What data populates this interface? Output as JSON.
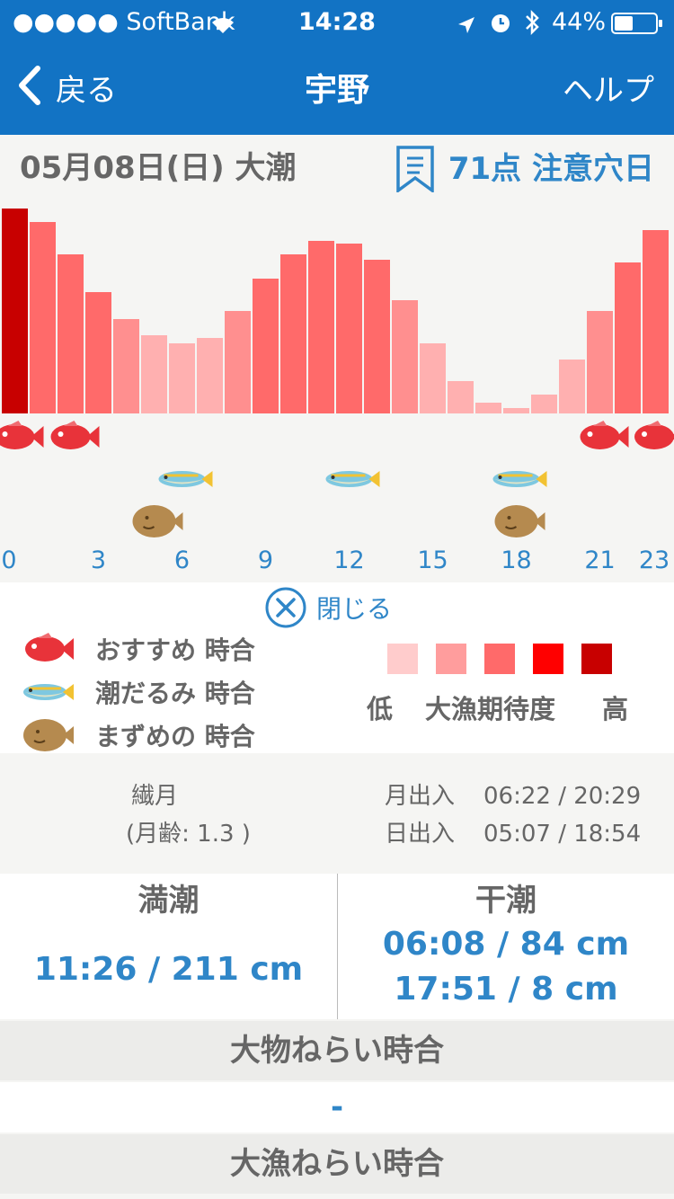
{
  "status": {
    "carrier": "●●●●● SoftBank",
    "time": "14:28",
    "battery": "44%"
  },
  "nav": {
    "back": "戻る",
    "title": "宇野",
    "help": "ヘルプ"
  },
  "header": {
    "date": "05月08日(日) 大潮",
    "score": "71点 注意穴日"
  },
  "chart_data": {
    "type": "bar",
    "categories": [
      0,
      1,
      2,
      3,
      4,
      5,
      6,
      7,
      8,
      9,
      10,
      11,
      12,
      13,
      14,
      15,
      16,
      17,
      18,
      19,
      20,
      21,
      22,
      23
    ],
    "values": [
      76,
      71,
      59,
      45,
      35,
      29,
      26,
      28,
      38,
      50,
      59,
      64,
      63,
      57,
      42,
      26,
      12,
      4,
      2,
      7,
      20,
      38,
      56,
      68
    ],
    "ylim": [
      0,
      80
    ],
    "level_colors": [
      "#c80000",
      "#ff6a6a",
      "#ff8f8f",
      "#ffb0b0"
    ],
    "x_tick_labels": [
      "0",
      "3",
      "6",
      "9",
      "12",
      "15",
      "18",
      "21",
      "23"
    ],
    "markers": {
      "recommend": [
        0,
        2,
        21,
        23
      ],
      "tide": [
        6,
        12,
        18
      ],
      "mazume": [
        5,
        18
      ]
    }
  },
  "legend": {
    "close": "閉じる",
    "items": [
      {
        "icon": "red-fish-icon",
        "label": "おすすめ 時合"
      },
      {
        "icon": "blue-fish-icon",
        "label": "潮だるみ 時合"
      },
      {
        "icon": "flatfish-icon",
        "label": "まずめの 時合"
      }
    ],
    "levels": [
      "#ffcccc",
      "#ff9d9d",
      "#ff6a6a",
      "#ff0000",
      "#c80000"
    ],
    "low": "低",
    "mid": "大漁期待度",
    "high": "高"
  },
  "moon": {
    "phase": "繊月",
    "age": "(月齢: 1.3 )",
    "moon_label": "月出入",
    "moon_times": "06:22 / 20:29",
    "sun_label": "日出入",
    "sun_times": "05:07 / 18:54"
  },
  "tides": {
    "high_label": "満潮",
    "high_values": [
      "11:26 / 211 cm"
    ],
    "low_label": "干潮",
    "low_values": [
      "06:08 / 84 cm",
      "17:51 / 8 cm"
    ]
  },
  "sections": {
    "big_catch_title": "大物ねらい時合",
    "big_catch_value": "-",
    "haul_title": "大漁ねらい時合"
  }
}
